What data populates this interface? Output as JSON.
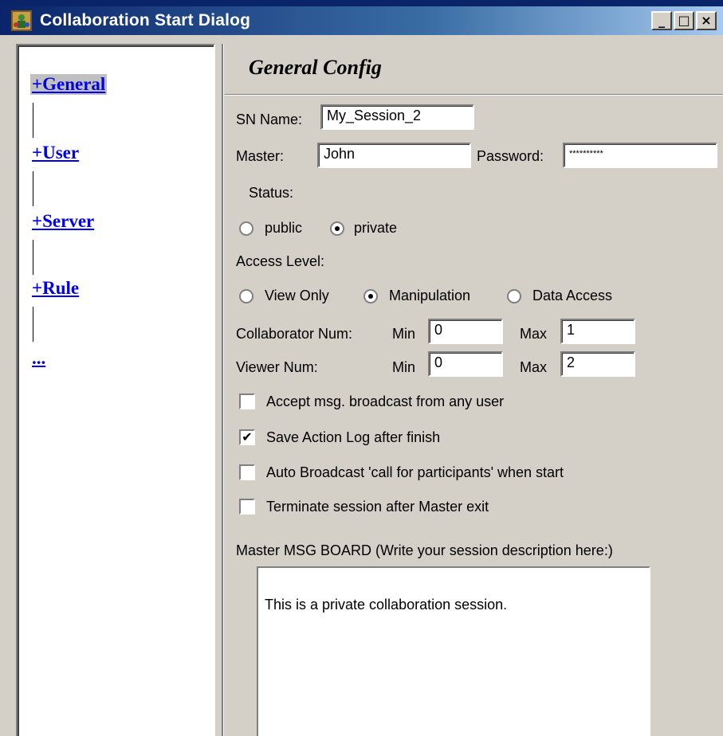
{
  "window": {
    "title": "Collaboration Start Dialog",
    "controls": {
      "minimize": "_",
      "maximize": "□",
      "close": "×"
    }
  },
  "nav": {
    "items": [
      {
        "label": "+General",
        "selected": true
      },
      {
        "label": "+User"
      },
      {
        "label": "+Server"
      },
      {
        "label": "+Rule"
      },
      {
        "label": "..."
      }
    ]
  },
  "config": {
    "heading": "General Config",
    "sn_name": {
      "label": "SN Name:",
      "value": "My_Session_2"
    },
    "master": {
      "label": "Master:",
      "value": "John"
    },
    "password": {
      "label": "Password:",
      "value": "**********"
    },
    "status": {
      "label": "Status:",
      "options": [
        {
          "label": "public",
          "selected": false
        },
        {
          "label": "private",
          "selected": true
        }
      ]
    },
    "access_level": {
      "label": "Access Level:",
      "options": [
        {
          "label": "View Only",
          "selected": false
        },
        {
          "label": "Manipulation",
          "selected": true
        },
        {
          "label": "Data Access",
          "selected": false
        }
      ]
    },
    "collaborator_num": {
      "label": "Collaborator Num:",
      "min_label": "Min",
      "min": "0",
      "max_label": "Max",
      "max": "1"
    },
    "viewer_num": {
      "label": "Viewer Num:",
      "min_label": "Min",
      "min": "0",
      "max_label": "Max",
      "max": "2"
    },
    "checkboxes": [
      {
        "label": "Accept msg. broadcast from any user",
        "checked": false
      },
      {
        "label": "Save Action Log after finish",
        "checked": true
      },
      {
        "label": "Auto Broadcast 'call for participants' when start",
        "checked": false
      },
      {
        "label": "Terminate session after Master exit",
        "checked": false
      }
    ],
    "msg_board": {
      "label": "Master MSG BOARD (Write your session description here:)",
      "text": "This is a private collaboration session."
    }
  },
  "colors": {
    "title_bar": "#0a246a",
    "link": "#0000ee",
    "face": "#d4d0c8"
  }
}
